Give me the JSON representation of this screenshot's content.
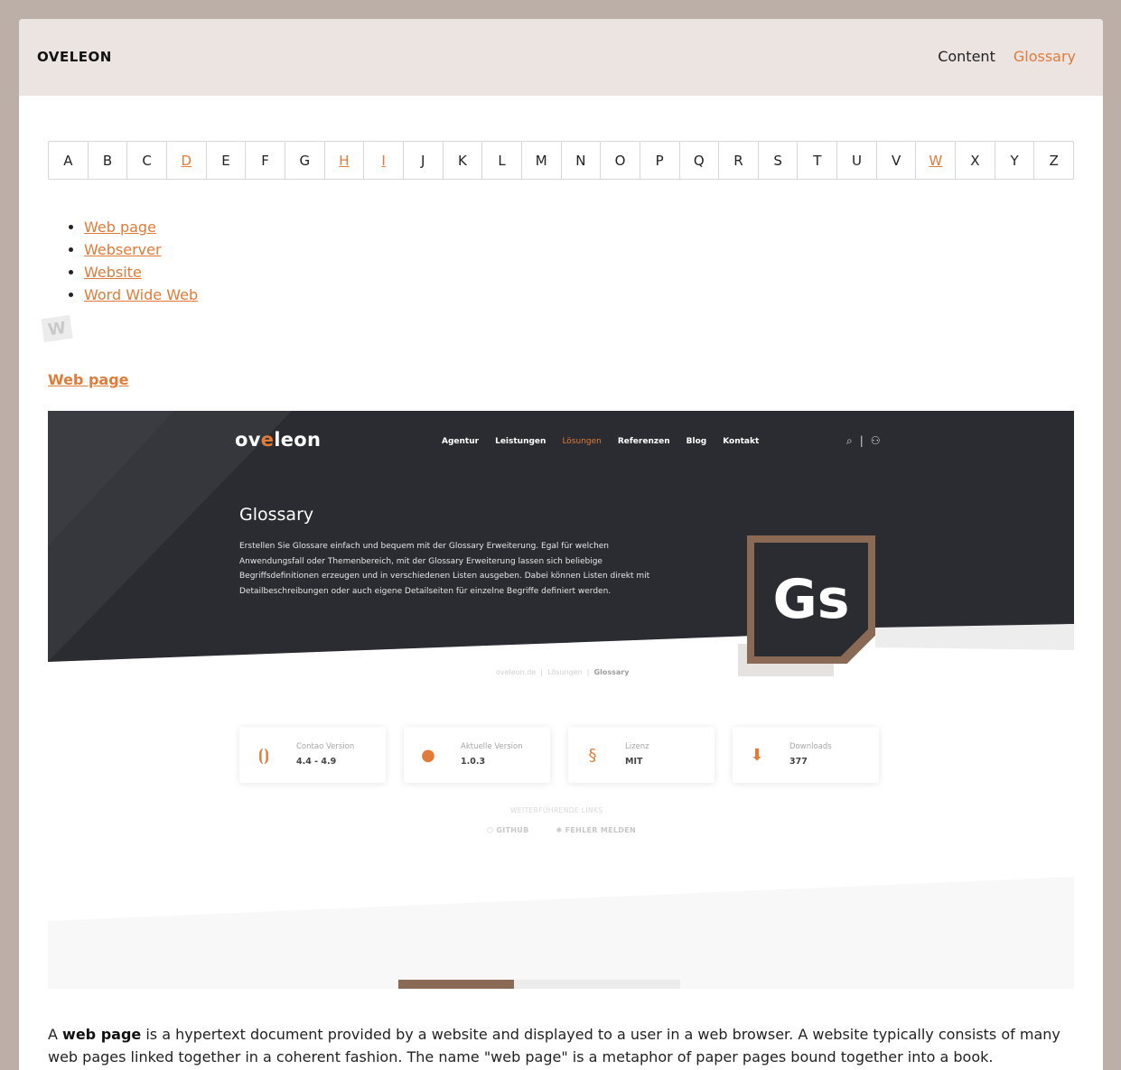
{
  "header": {
    "brand": "OVELEON",
    "nav": [
      {
        "label": "Content",
        "active": false
      },
      {
        "label": "Glossary",
        "active": true
      }
    ]
  },
  "alphabet": {
    "letters": [
      "A",
      "B",
      "C",
      "D",
      "E",
      "F",
      "G",
      "H",
      "I",
      "J",
      "K",
      "L",
      "M",
      "N",
      "O",
      "P",
      "Q",
      "R",
      "S",
      "T",
      "U",
      "V",
      "W",
      "X",
      "Y",
      "Z"
    ],
    "linked": [
      "D",
      "H",
      "I",
      "W"
    ]
  },
  "terms": [
    "Web page",
    "Webserver",
    "Website",
    "Word Wide Web"
  ],
  "section_letter": "W",
  "entry": {
    "title": "Web page",
    "description_lead": "A ",
    "description_bold": "web page",
    "description_rest": " is a hypertext document provided by a website and displayed to a user in a web browser. A website typically consists of many web pages linked together in a coherent fashion. The name \"web page\" is a metaphor of paper pages bound together into a book."
  },
  "screenshot": {
    "logo_prefix": "ov",
    "logo_accent": "e",
    "logo_suffix": "leon",
    "nav": [
      "Agentur",
      "Leistungen",
      "Lösungen",
      "Referenzen",
      "Blog",
      "Kontakt"
    ],
    "nav_active": "Lösungen",
    "title": "Glossary",
    "description": "Erstellen Sie Glossare einfach und bequem mit der Glossary Erweiterung. Egal für welchen Anwendungsfall oder Themenbereich, mit der Glossary Erweiterung lassen sich beliebige Begriffsdefinitionen erzeugen und in verschiedenen Listen ausgeben. Dabei können Listen direkt mit Detailbeschreibungen oder auch eigene Detailseiten für einzelne Begriffe definiert werden.",
    "tile_text": "Gs",
    "breadcrumb": {
      "first": "oveleon.de",
      "second": "Lösungen",
      "current": "Glossary"
    },
    "cards": [
      {
        "label": "Contao Version",
        "value": "4.4 - 4.9",
        "icon": "contao-icon"
      },
      {
        "label": "Aktuelle Version",
        "value": "1.0.3",
        "icon": "version-icon"
      },
      {
        "label": "Lizenz",
        "value": "MIT",
        "icon": "license-icon"
      },
      {
        "label": "Downloads",
        "value": "377",
        "icon": "download-icon"
      }
    ],
    "more_links_title": "WEITERFÜHRENDE LINKS",
    "link_github": "GITHUB",
    "link_bug": "FEHLER MELDEN"
  },
  "colors": {
    "accent": "#e07b39",
    "header_bg": "#ebe4e1",
    "backdrop": "#bcafa8",
    "hero_dark": "#2b2c32",
    "tile_border": "#8a6a55"
  }
}
